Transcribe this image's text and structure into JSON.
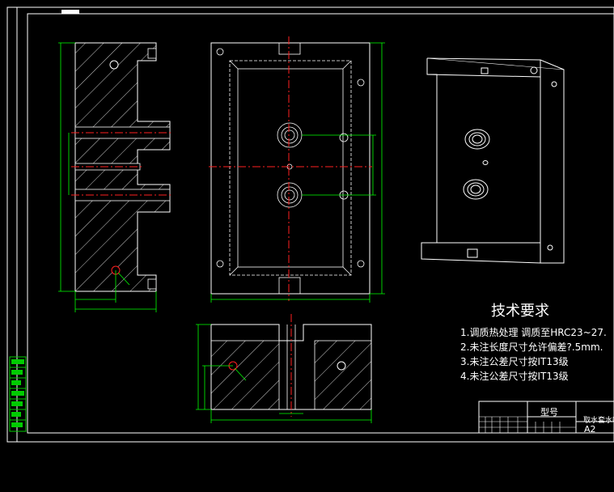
{
  "technical_requirements": {
    "title": "技术要求",
    "items": [
      "1.调质热处理  调质至HRC23~27.",
      "2.未注长度尺寸允许偏差?.5mm.",
      "3.未注公差尺寸按IT13级",
      "4.未注公差尺寸按IT13级"
    ]
  },
  "title_block": {
    "model_label": "型号",
    "part_name": "取水套水嘴",
    "sheet_size": "A2"
  },
  "colors": {
    "background": "#000000",
    "line": "#ffffff",
    "centerline": "#ff2020",
    "dimension": "#00ff00",
    "side_panel": "#00cc00"
  }
}
